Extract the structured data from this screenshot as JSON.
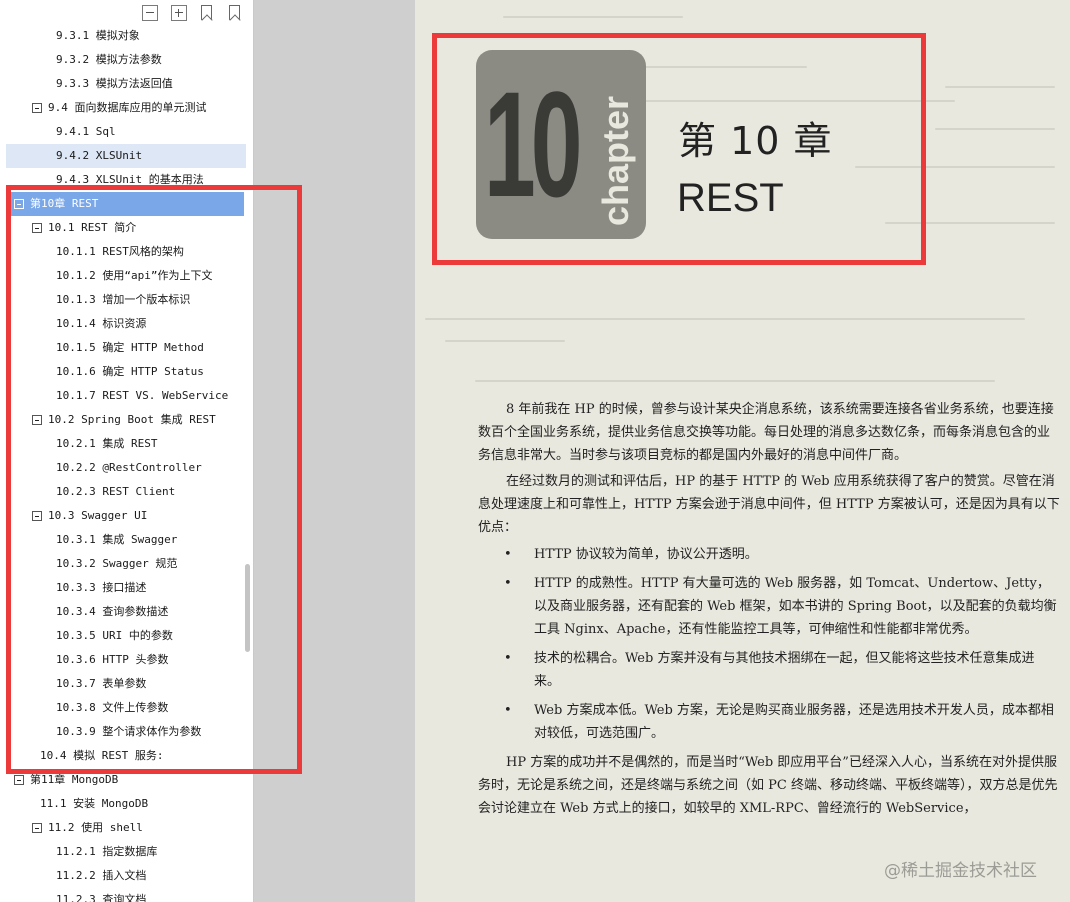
{
  "toc": {
    "items": [
      {
        "text": "9.3.1 模拟对象",
        "level": "l3"
      },
      {
        "text": "9.3.2 模拟方法参数",
        "level": "l3"
      },
      {
        "text": "9.3.3 模拟方法返回值",
        "level": "l3"
      },
      {
        "text": "9.4 面向数据库应用的单元测试",
        "level": "l2"
      },
      {
        "text": "9.4.1 Sql",
        "level": "l3"
      },
      {
        "text": "9.4.2 XLSUnit",
        "level": "sel"
      },
      {
        "text": "9.4.3 XLSUnit 的基本用法",
        "level": "l3"
      },
      {
        "text": "第10章 REST",
        "level": "ch-sel"
      },
      {
        "text": "10.1 REST 简介",
        "level": "l2"
      },
      {
        "text": "10.1.1 REST风格的架构",
        "level": "l3"
      },
      {
        "text": "10.1.2 使用“api”作为上下文",
        "level": "l3"
      },
      {
        "text": "10.1.3 增加一个版本标识",
        "level": "l3"
      },
      {
        "text": "10.1.4 标识资源",
        "level": "l3"
      },
      {
        "text": "10.1.5 确定 HTTP Method",
        "level": "l3"
      },
      {
        "text": "10.1.6 确定 HTTP Status",
        "level": "l3"
      },
      {
        "text": "10.1.7 REST VS. WebService",
        "level": "l3"
      },
      {
        "text": "10.2 Spring Boot 集成 REST",
        "level": "l2"
      },
      {
        "text": "10.2.1 集成 REST",
        "level": "l3"
      },
      {
        "text": "10.2.2 @RestController",
        "level": "l3"
      },
      {
        "text": "10.2.3 REST Client",
        "level": "l3"
      },
      {
        "text": "10.3 Swagger UI",
        "level": "l2"
      },
      {
        "text": "10.3.1 集成 Swagger",
        "level": "l3"
      },
      {
        "text": "10.3.2 Swagger 规范",
        "level": "l3"
      },
      {
        "text": "10.3.3 接口描述",
        "level": "l3"
      },
      {
        "text": "10.3.4 查询参数描述",
        "level": "l3"
      },
      {
        "text": "10.3.5 URI 中的参数",
        "level": "l3"
      },
      {
        "text": "10.3.6 HTTP 头参数",
        "level": "l3"
      },
      {
        "text": "10.3.7 表单参数",
        "level": "l3"
      },
      {
        "text": "10.3.8 文件上传参数",
        "level": "l3"
      },
      {
        "text": "10.3.9 整个请求体作为参数",
        "level": "l3"
      },
      {
        "text": "10.4 模拟 REST 服务:",
        "level": "l2n"
      },
      {
        "text": "第11章 MongoDB",
        "level": "l1"
      },
      {
        "text": "11.1 安装 MongoDB",
        "level": "l2n"
      },
      {
        "text": "11.2 使用 shell",
        "level": "l2"
      },
      {
        "text": "11.2.1 指定数据库",
        "level": "l3"
      },
      {
        "text": "11.2.2 插入文档",
        "level": "l3"
      },
      {
        "text": "11.2.3 查询文档",
        "level": "l3"
      }
    ]
  },
  "chapter": {
    "logo_number": "10",
    "logo_word": "chapter",
    "title": "第 10 章",
    "subtitle": "REST"
  },
  "body": {
    "p1": "8 年前我在 HP 的时候，曾参与设计某央企消息系统，该系统需要连接各省业务系统，也要连接数百个全国业务系统，提供业务信息交换等功能。每日处理的消息多达数亿条，而每条消息包含的业务信息非常大。当时参与该项目竞标的都是国内外最好的消息中间件厂商。",
    "p2": "在经过数月的测试和评估后，HP 的基于 HTTP 的 Web 应用系统获得了客户的赞赏。尽管在消息处理速度上和可靠性上，HTTP 方案会逊于消息中间件，但 HTTP 方案被认可，还是因为具有以下优点：",
    "bullets": [
      "HTTP 协议较为简单，协议公开透明。",
      "HTTP 的成熟性。HTTP 有大量可选的 Web 服务器，如 Tomcat、Undertow、Jetty，以及商业服务器，还有配套的 Web 框架，如本书讲的 Spring Boot，以及配套的负载均衡工具 Nginx、Apache，还有性能监控工具等，可伸缩性和性能都非常优秀。",
      "技术的松耦合。Web 方案并没有与其他技术捆绑在一起，但又能将这些技术任意集成进来。",
      "Web 方案成本低。Web 方案，无论是购买商业服务器，还是选用技术开发人员，成本都相对较低，可选范围广。"
    ],
    "p3": "HP 方案的成功并不是偶然的，而是当时“Web 即应用平台”已经深入人心，当系统在对外提供服务时，无论是系统之间，还是终端与系统之间（如 PC 终端、移动终端、平板终端等），双方总是优先会讨论建立在 Web 方式上的接口，如较早的 XML-RPC、曾经流行的 WebService，"
  },
  "watermark": "@稀土掘金技术社区"
}
